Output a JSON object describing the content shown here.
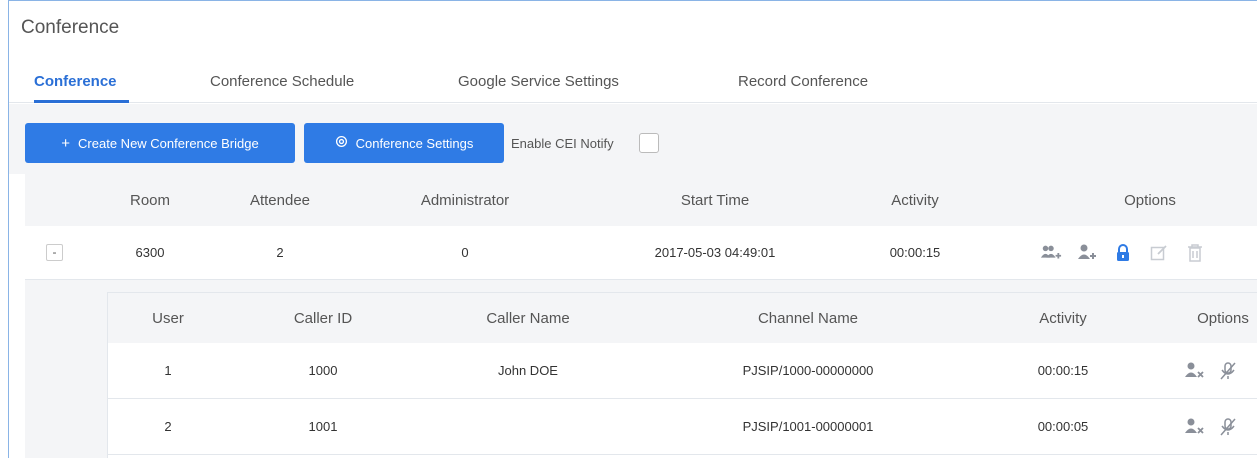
{
  "page": {
    "title": "Conference"
  },
  "tabs": [
    {
      "label": "Conference",
      "active": true
    },
    {
      "label": "Conference Schedule",
      "active": false
    },
    {
      "label": "Google Service Settings",
      "active": false
    },
    {
      "label": "Record Conference",
      "active": false
    }
  ],
  "toolbar": {
    "create_label": "Create New Conference Bridge",
    "create_icon": "plus-icon",
    "settings_label": "Conference Settings",
    "settings_icon": "gear-icon",
    "cei_label": "Enable CEI Notify",
    "cei_checked": false
  },
  "table": {
    "columns": [
      "Room",
      "Attendee",
      "Administrator",
      "Start Time",
      "Activity",
      "Options"
    ],
    "rows": [
      {
        "expander": "-",
        "room": "6300",
        "attendee": "2",
        "administrator": "0",
        "start_time": "2017-05-03 04:49:01",
        "activity": "00:00:15",
        "options": [
          "invite-users-icon",
          "add-user-icon",
          "lock-icon",
          "edit-icon",
          "delete-icon"
        ]
      }
    ]
  },
  "subtable": {
    "columns": [
      "User",
      "Caller ID",
      "Caller Name",
      "Channel Name",
      "Activity",
      "Options"
    ],
    "rows": [
      {
        "user": "1",
        "caller_id": "1000",
        "caller_name": "John DOE",
        "channel_name": "PJSIP/1000-00000000",
        "activity": "00:00:15",
        "options": [
          "kick-user-icon",
          "mute-icon"
        ]
      },
      {
        "user": "2",
        "caller_id": "1001",
        "caller_name": "",
        "channel_name": "PJSIP/1001-00000001",
        "activity": "00:00:05",
        "options": [
          "kick-user-icon",
          "mute-icon"
        ]
      }
    ]
  },
  "colors": {
    "accent": "#2f7be5",
    "active_tab": "#2a6fd6",
    "icon": "#8a8f99",
    "icon_disabled": "#c8ccd2",
    "lock": "#2f7be5"
  }
}
